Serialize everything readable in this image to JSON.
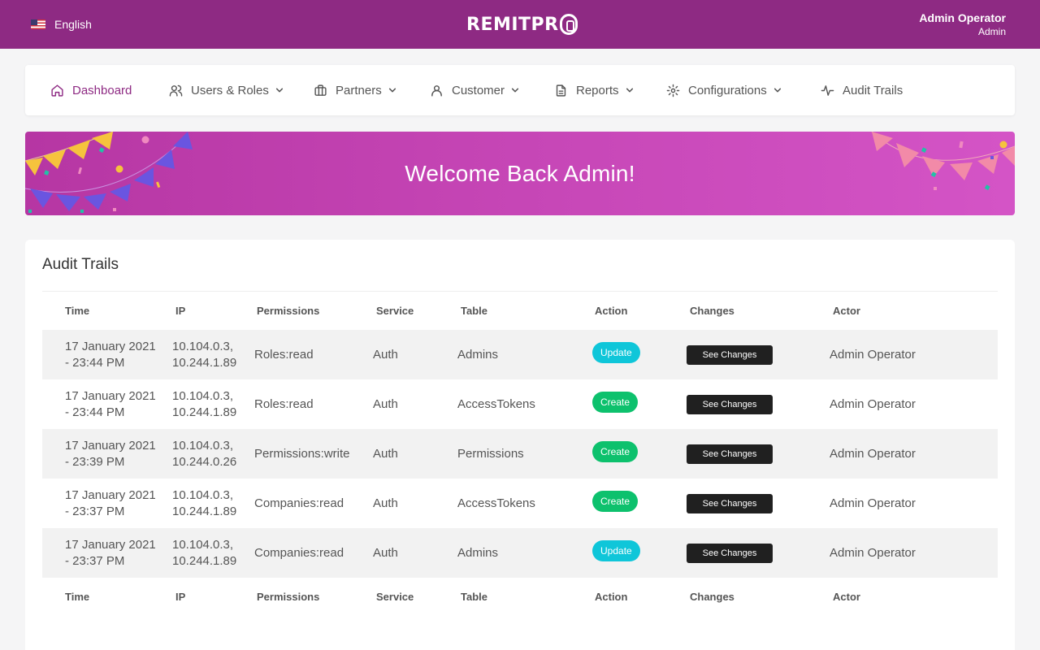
{
  "header": {
    "language": "English",
    "logo": "REMITPRO",
    "user_name": "Admin Operator",
    "user_role": "Admin"
  },
  "nav": {
    "items": [
      {
        "label": "Dashboard",
        "icon": "home-icon",
        "dropdown": false,
        "active": true
      },
      {
        "label": "Users & Roles",
        "icon": "users-icon",
        "dropdown": true
      },
      {
        "label": "Partners",
        "icon": "briefcase-icon",
        "dropdown": true
      },
      {
        "label": "Customer",
        "icon": "user-icon",
        "dropdown": true
      },
      {
        "label": "Reports",
        "icon": "document-icon",
        "dropdown": true
      },
      {
        "label": "Configurations",
        "icon": "gear-icon",
        "dropdown": true
      },
      {
        "label": "Audit Trails",
        "icon": "activity-icon",
        "dropdown": false
      }
    ]
  },
  "banner": {
    "title": "Welcome Back Admin!"
  },
  "audit": {
    "title": "Audit Trails",
    "columns": [
      "Time",
      "IP",
      "Permissions",
      "Service",
      "Table",
      "Action",
      "Changes",
      "Actor"
    ],
    "rows": [
      {
        "time1": "17 January 2021",
        "time2": "- 23:44 PM",
        "ip1": "10.104.0.3,",
        "ip2": "10.244.1.89",
        "permissions": "Roles:read",
        "service": "Auth",
        "table": "Admins",
        "action": "Update",
        "changes": "See Changes",
        "actor": "Admin Operator"
      },
      {
        "time1": "17 January 2021",
        "time2": "- 23:44 PM",
        "ip1": "10.104.0.3,",
        "ip2": "10.244.1.89",
        "permissions": "Roles:read",
        "service": "Auth",
        "table": "AccessTokens",
        "action": "Create",
        "changes": "See Changes",
        "actor": "Admin Operator"
      },
      {
        "time1": "17 January 2021",
        "time2": "- 23:39 PM",
        "ip1": "10.104.0.3,",
        "ip2": "10.244.0.26",
        "permissions": "Permissions:write",
        "service": "Auth",
        "table": "Permissions",
        "action": "Create",
        "changes": "See Changes",
        "actor": "Admin Operator"
      },
      {
        "time1": "17 January 2021",
        "time2": "- 23:37 PM",
        "ip1": "10.104.0.3,",
        "ip2": "10.244.1.89",
        "permissions": "Companies:read",
        "service": "Auth",
        "table": "AccessTokens",
        "action": "Create",
        "changes": "See Changes",
        "actor": "Admin Operator"
      },
      {
        "time1": "17 January 2021",
        "time2": "- 23:37 PM",
        "ip1": "10.104.0.3,",
        "ip2": "10.244.1.89",
        "permissions": "Companies:read",
        "service": "Auth",
        "table": "Admins",
        "action": "Update",
        "changes": "See Changes",
        "actor": "Admin Operator"
      }
    ]
  },
  "colors": {
    "brand": "#8e2a83",
    "update_badge": "#0fc6d9",
    "create_badge": "#0dc16d",
    "button_dark": "#202020"
  }
}
